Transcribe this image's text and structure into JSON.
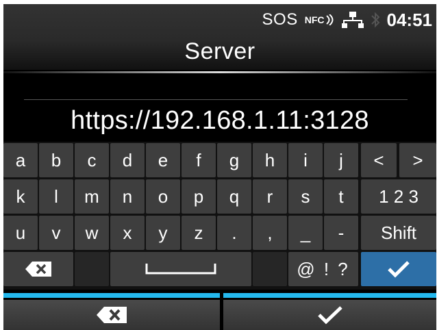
{
  "status": {
    "sos": "SOS",
    "nfc": "NFC",
    "time": "04:51"
  },
  "title": "Server",
  "value": "https://192.168.1.11:3128",
  "keys": {
    "row1": [
      "a",
      "b",
      "c",
      "d",
      "e",
      "f",
      "g",
      "h",
      "i",
      "j",
      "<",
      ">"
    ],
    "row2": [
      "k",
      "l",
      "m",
      "n",
      "o",
      "p",
      "q",
      "r",
      "s",
      "t",
      "1 2 3"
    ],
    "row3": [
      "u",
      "v",
      "w",
      "x",
      "y",
      "z",
      ".",
      ",",
      "_",
      "-",
      "Shift"
    ],
    "symbols": "@ ! ?"
  },
  "icons": {
    "backspace": "backspace-icon",
    "space": "space-icon",
    "ok": "checkmark-icon",
    "network": "network-icon",
    "bluetooth": "bluetooth-icon"
  },
  "colors": {
    "accent_blue": "#24b8ee",
    "ok_key": "#2d6fa7",
    "key": "#3e3e3e"
  }
}
